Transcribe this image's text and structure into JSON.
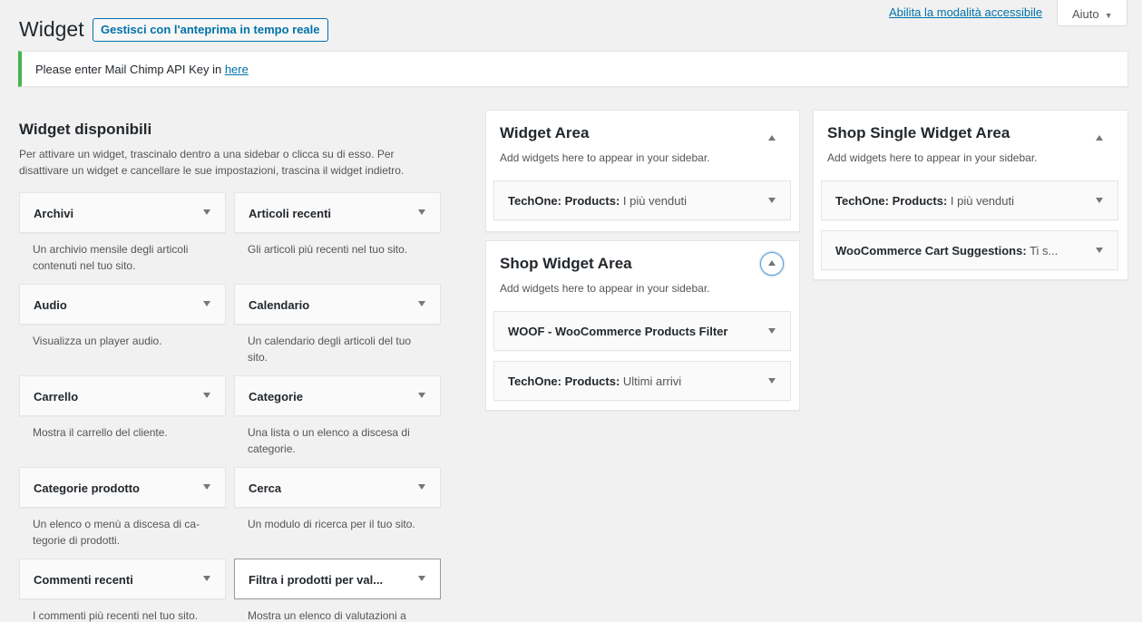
{
  "header": {
    "title": "Widget",
    "preview_button": "Gestisci con l'anteprima in tempo reale",
    "accessibility_link": "Abilita la modalità accessibile",
    "help_tab": "Aiuto"
  },
  "notice": {
    "text": "Please enter Mail Chimp API Key in ",
    "link": "here",
    "accent_color": "#46b450"
  },
  "available": {
    "title": "Widget disponibili",
    "description": "Per attivare un widget, trascinalo dentro a una sidebar o clicca su di esso. Per disattivare un widget e cancellare le sue impostazioni, trascina il widget indietro.",
    "widgets": [
      {
        "name": "Archivi",
        "desc": "Un archivio mensile degli articoli contenuti nel tuo sito."
      },
      {
        "name": "Articoli recenti",
        "desc": "Gli articoli più recenti nel tuo sito."
      },
      {
        "name": "Audio",
        "desc": "Visualizza un player audio."
      },
      {
        "name": "Calendario",
        "desc": "Un calendario degli articoli del tuo sito."
      },
      {
        "name": "Carrello",
        "desc": "Mostra il carrello del cliente."
      },
      {
        "name": "Categorie",
        "desc": "Una lista o un elenco a discesa di categorie."
      },
      {
        "name": "Categorie prodotto",
        "desc": "Un elenco o menù a discesa di ca-tegorie di prodotti."
      },
      {
        "name": "Cerca",
        "desc": "Un modulo di ricerca per il tuo sito."
      },
      {
        "name": "Commenti recenti",
        "desc": "I commenti più recenti nel tuo sito."
      },
      {
        "name": "Filtra i prodotti per val...",
        "desc": "Mostra un elenco di valutazioni a"
      }
    ]
  },
  "sidebars": {
    "widget_area": {
      "title": "Widget Area",
      "desc": "Add widgets here to appear in your sidebar.",
      "items": [
        {
          "name": "TechOne: Products:",
          "instance": " I più venduti"
        }
      ]
    },
    "shop_widget_area": {
      "title": "Shop Widget Area",
      "desc": "Add widgets here to appear in your sidebar.",
      "items": [
        {
          "name": "WOOF - WooCommerce Products Filter",
          "instance": ""
        },
        {
          "name": "TechOne: Products:",
          "instance": " Ultimi arrivi"
        }
      ]
    },
    "shop_single": {
      "title": "Shop Single Widget Area",
      "desc": "Add widgets here to appear in your sidebar.",
      "items": [
        {
          "name": "TechOne: Products:",
          "instance": " I più venduti"
        },
        {
          "name": "WooCommerce Cart Suggestions:",
          "instance": " Ti s..."
        }
      ]
    }
  }
}
